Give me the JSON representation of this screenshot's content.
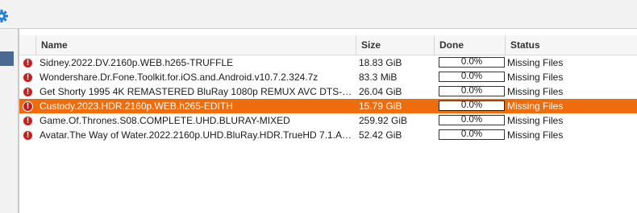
{
  "columns": {
    "name": "Name",
    "size": "Size",
    "done": "Done",
    "status": "Status"
  },
  "accent_colors": {
    "selected_row": "#ef6c0c",
    "error_icon": "#d11b1b"
  },
  "icons": {
    "toolbar": "gear-icon",
    "row_status": "error-icon"
  },
  "rows": [
    {
      "name": "Sidney.2022.DV.2160p.WEB.h265-TRUFFLE",
      "size": "18.83 GiB",
      "done_label": "0.0%",
      "done_value": 0.0,
      "status": "Missing Files"
    },
    {
      "name": "Wondershare.Dr.Fone.Toolkit.for.iOS.and.Android.v10.7.2.324.7z",
      "size": "83.3 MiB",
      "done_label": "0.0%",
      "done_value": 0.0,
      "status": "Missing Files"
    },
    {
      "name": "Get Shorty 1995 4K REMASTERED BluRay 1080p REMUX AVC DTS-…",
      "size": "26.04 GiB",
      "done_label": "0.0%",
      "done_value": 0.0,
      "status": "Missing Files"
    },
    {
      "name": "Custody.2023.HDR.2160p.WEB.h265-EDITH",
      "size": "15.79 GiB",
      "done_label": "0.0%",
      "done_value": 0.0,
      "status": "Missing Files"
    },
    {
      "name": "Game.Of.Thrones.S08.COMPLETE.UHD.BLURAY-MIXED",
      "size": "259.92 GiB",
      "done_label": "0.0%",
      "done_value": 0.0,
      "status": "Missing Files"
    },
    {
      "name": "Avatar.The Way of Water.2022.2160p.UHD.BluRay.HDR.TrueHD 7.1.At…",
      "size": "52.42 GiB",
      "done_label": "0.0%",
      "done_value": 0.0,
      "status": "Missing Files"
    }
  ]
}
